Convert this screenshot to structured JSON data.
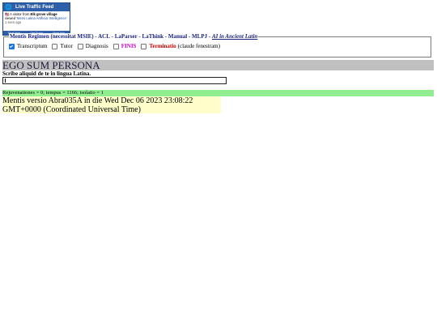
{
  "widget": {
    "title": "Live Traffic Feed",
    "visitor_prefix": "A visitor from",
    "visitor_location": "Elk grove village",
    "viewed_text": "viewed",
    "viewed_page": "'Mens Latina Artificial Intelligence'",
    "time_ago": "1 secs ago",
    "footer_links": [
      "Real-time",
      "Get Script",
      "More Info"
    ]
  },
  "regimen": {
    "legend_title": "Mentis Regimen (necessitat MSIE)",
    "links": [
      "ACL",
      "LaParser",
      "LaThink",
      "Manual",
      "MLPJ"
    ],
    "ai_link": "AI in Ancient Latin",
    "options": [
      {
        "label": "Transcriptum",
        "checked": true
      },
      {
        "label": "Tutor",
        "checked": false
      },
      {
        "label": "Diagnosis",
        "checked": false
      },
      {
        "label": "FINIS",
        "checked": false
      },
      {
        "label": "Terminatio",
        "checked": false
      }
    ],
    "terminatio_note": "(claude fenestram)"
  },
  "persona": {
    "heading": "EGO SUM PERSONA"
  },
  "input": {
    "prompt": "Scribe aliquid de te in lingua Latina.",
    "value": ""
  },
  "status": {
    "text": "Rejuvenationes = 0; tempus = 1166; isolatio = 1"
  },
  "version": {
    "text": "Mentis versio Abra035A in die Wed Dec 06 2023 23:08:22 GMT+0000 (Coordinated Universal Time)"
  },
  "colors": {
    "widget_blue": "#2f5fa8",
    "status_green": "#90ee90",
    "version_yellow": "#ffffcc",
    "persona_gray": "#c0c0c0"
  }
}
